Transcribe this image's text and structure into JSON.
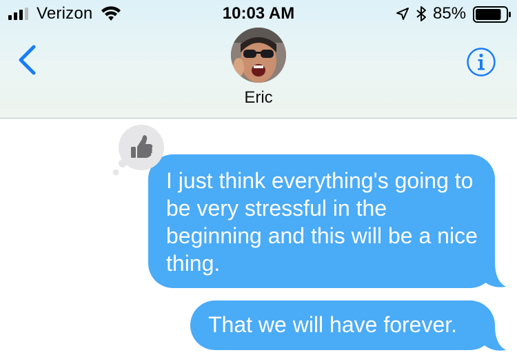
{
  "status_bar": {
    "carrier": "Verizon",
    "time": "10:03 AM",
    "battery_percent": "85%",
    "battery_level": 0.85,
    "icons": [
      "signal-icon",
      "wifi-icon",
      "location-icon",
      "bluetooth-icon",
      "battery-icon"
    ]
  },
  "nav": {
    "contact_name": "Eric",
    "back_icon": "chevron-left-icon",
    "info_icon": "info-icon",
    "accent_color": "#1a7cf5"
  },
  "messages": [
    {
      "sender": "me",
      "text": "I just think everything's going to be very stressful in the beginning and this will be a nice thing.",
      "tapback": "thumbs-up-icon"
    },
    {
      "sender": "me",
      "text": "That we will have forever."
    }
  ],
  "colors": {
    "sent_bubble": "#4aabf7",
    "header_bg": "#e3f3f6",
    "tapback_bg": "#e6e6e8",
    "tapback_icon": "#6d6d72"
  }
}
